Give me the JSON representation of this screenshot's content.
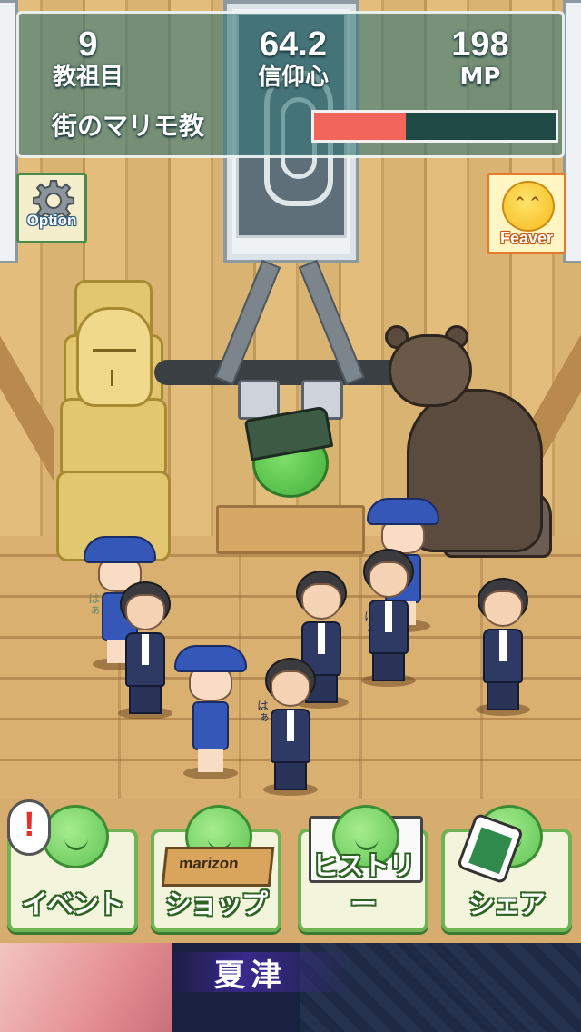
{
  "hud": {
    "stats": [
      {
        "value": "9",
        "label": "教祖目"
      },
      {
        "value": "64.2",
        "label": "信仰心"
      },
      {
        "value": "198",
        "label": "MP"
      }
    ],
    "religion_name": "街のマリモ教",
    "progress_fraction": 0.38,
    "colors": {
      "progress_fill": "#f1655a",
      "progress_track": "#1f4a46",
      "hud_bg": "#377878"
    }
  },
  "buttons": {
    "option": {
      "label": "Option",
      "icon": "gear-icon"
    },
    "feaver": {
      "label": "Feaver",
      "icon": "sun-mascot-icon"
    }
  },
  "scene": {
    "people_text": [
      "はぁ",
      "はぁ",
      "はぁ"
    ],
    "box_text": "marizon"
  },
  "menu": {
    "items": [
      {
        "label": "イベント",
        "icon": "marimo-mascot-icon"
      },
      {
        "label": "ショップ",
        "icon": "marimo-box-icon"
      },
      {
        "label": "ヒストリー",
        "icon": "marimo-book-icon"
      },
      {
        "label": "シェア",
        "icon": "marimo-phone-icon"
      }
    ],
    "alert": "!",
    "colors": {
      "button_border": "#6fb354",
      "button_bg": "#f3f4dc"
    }
  },
  "banner": {
    "title": "夏津"
  }
}
